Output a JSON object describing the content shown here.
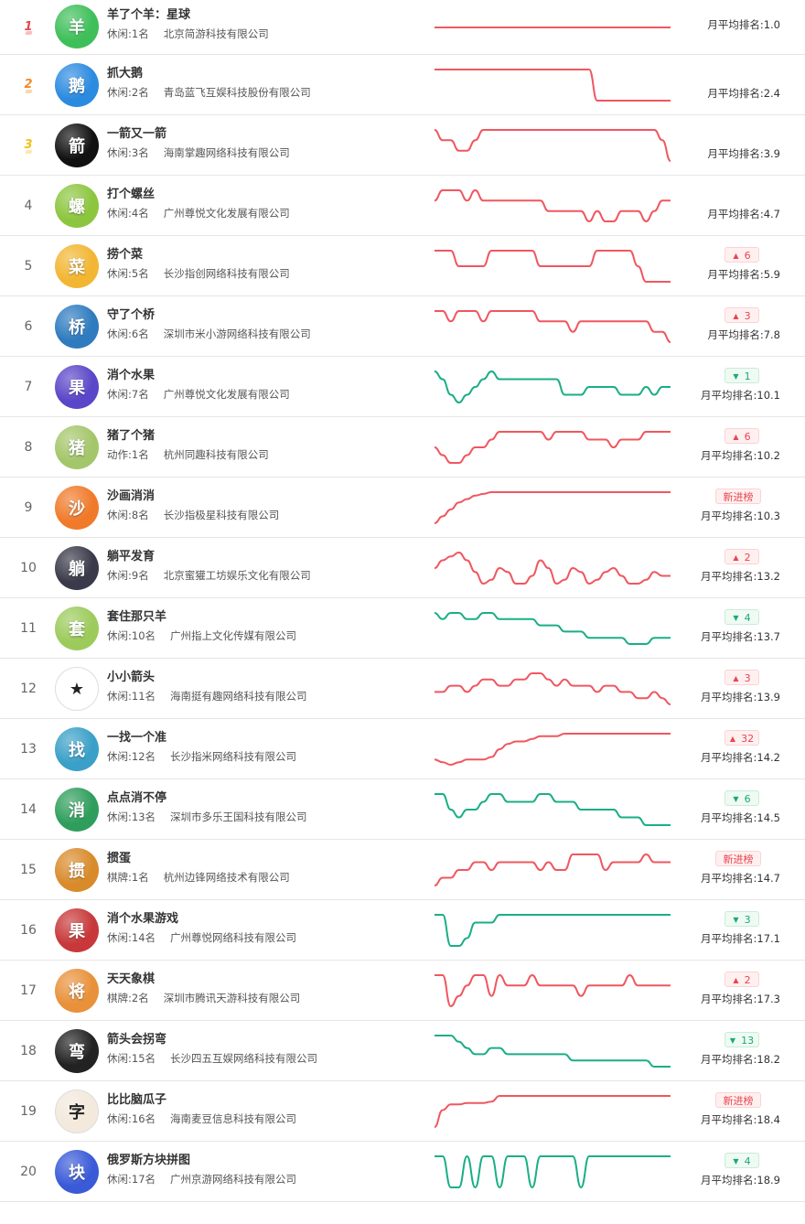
{
  "colors": {
    "up": "#e8464f",
    "down": "#18a979",
    "line_red": "#f0575f",
    "line_green": "#1aae86"
  },
  "rows": [
    {
      "rank": "1",
      "name": "羊了个羊：星球",
      "category": "休闲:1名",
      "company": "北京简游科技有限公司",
      "avg": "月平均排名:1.0",
      "badge": null,
      "badge_type": "none",
      "line_color": "red",
      "icon": "sheep-game-icon",
      "icon_text": "羊",
      "icon_bg": "#3fbf5a",
      "trend": [
        30,
        30,
        30,
        30,
        30,
        30,
        30,
        30,
        30,
        30,
        30,
        30,
        30,
        30,
        30,
        30,
        30,
        30,
        30,
        30,
        30,
        30,
        30,
        30,
        30,
        30,
        30,
        30,
        30,
        30
      ]
    },
    {
      "rank": "2",
      "name": "抓大鹅",
      "category": "休闲:2名",
      "company": "青岛蓝飞互娱科技股份有限公司",
      "avg": "月平均排名:2.4",
      "badge": null,
      "badge_type": "none",
      "line_color": "red",
      "icon": "goose-game-icon",
      "icon_text": "鹅",
      "icon_bg": "#2b8be0",
      "trend": [
        2,
        2,
        2,
        2,
        2,
        2,
        2,
        2,
        2,
        2,
        2,
        2,
        2,
        2,
        2,
        2,
        2,
        2,
        2,
        2,
        3,
        3,
        3,
        3,
        3,
        3,
        3,
        3,
        3,
        3
      ]
    },
    {
      "rank": "3",
      "name": "一箭又一箭",
      "category": "休闲:3名",
      "company": "海南掌趣网络科技有限公司",
      "avg": "月平均排名:3.9",
      "badge": null,
      "badge_type": "none",
      "line_color": "red",
      "icon": "arrow-game-icon",
      "icon_text": "箭",
      "icon_bg": "#111111",
      "trend": [
        3,
        4,
        4,
        5,
        5,
        4,
        3,
        3,
        3,
        3,
        3,
        3,
        3,
        3,
        3,
        3,
        3,
        3,
        3,
        3,
        3,
        3,
        3,
        3,
        3,
        3,
        3,
        3,
        4,
        6
      ]
    },
    {
      "rank": "4",
      "name": "打个螺丝",
      "category": "休闲:4名",
      "company": "广州尊悦文化发展有限公司",
      "avg": "月平均排名:4.7",
      "badge": null,
      "badge_type": "none",
      "line_color": "red",
      "icon": "screw-game-icon",
      "icon_text": "螺",
      "icon_bg": "#8cc63f",
      "trend": [
        3,
        2,
        2,
        2,
        3,
        2,
        3,
        3,
        3,
        3,
        3,
        3,
        3,
        3,
        4,
        4,
        4,
        4,
        4,
        5,
        4,
        5,
        5,
        4,
        4,
        4,
        5,
        4,
        3,
        3
      ]
    },
    {
      "rank": "5",
      "name": "捞个菜",
      "category": "休闲:5名",
      "company": "长沙指创网络科技有限公司",
      "avg": "月平均排名:5.9",
      "badge": "6",
      "badge_type": "up",
      "line_color": "red",
      "icon": "dish-game-icon",
      "icon_text": "菜",
      "icon_bg": "#f2b632",
      "trend": [
        5,
        5,
        5,
        6,
        6,
        6,
        6,
        5,
        5,
        5,
        5,
        5,
        5,
        6,
        6,
        6,
        6,
        6,
        6,
        6,
        5,
        5,
        5,
        5,
        5,
        6,
        7,
        7,
        7,
        7
      ]
    },
    {
      "rank": "6",
      "name": "守了个桥",
      "category": "休闲:6名",
      "company": "深圳市米小游网络科技有限公司",
      "avg": "月平均排名:7.8",
      "badge": "3",
      "badge_type": "up",
      "line_color": "red",
      "icon": "bridge-game-icon",
      "icon_text": "桥",
      "icon_bg": "#2e7bbf",
      "trend": [
        6,
        6,
        7,
        6,
        6,
        6,
        7,
        6,
        6,
        6,
        6,
        6,
        6,
        7,
        7,
        7,
        7,
        8,
        7,
        7,
        7,
        7,
        7,
        7,
        7,
        7,
        7,
        8,
        8,
        9
      ]
    },
    {
      "rank": "7",
      "name": "消个水果",
      "category": "休闲:7名",
      "company": "广州尊悦文化发展有限公司",
      "avg": "月平均排名:10.1",
      "badge": "1",
      "badge_type": "down",
      "line_color": "green",
      "icon": "fruit-game-icon",
      "icon_text": "果",
      "icon_bg": "#5a46c8",
      "trend": [
        8,
        9,
        11,
        12,
        11,
        10,
        9,
        8,
        9,
        9,
        9,
        9,
        9,
        9,
        9,
        9,
        11,
        11,
        11,
        10,
        10,
        10,
        10,
        11,
        11,
        11,
        10,
        11,
        10,
        10
      ]
    },
    {
      "rank": "8",
      "name": "猪了个猪",
      "category": "动作:1名",
      "company": "杭州同趣科技有限公司",
      "avg": "月平均排名:10.2",
      "badge": "6",
      "badge_type": "up",
      "line_color": "red",
      "icon": "pig-game-icon",
      "icon_text": "猪",
      "icon_bg": "#a4c66b",
      "trend": [
        12,
        13,
        14,
        14,
        13,
        12,
        12,
        11,
        10,
        10,
        10,
        10,
        10,
        10,
        11,
        10,
        10,
        10,
        10,
        11,
        11,
        11,
        12,
        11,
        11,
        11,
        10,
        10,
        10,
        10
      ]
    },
    {
      "rank": "9",
      "name": "沙画消消",
      "category": "休闲:8名",
      "company": "长沙指极星科技有限公司",
      "avg": "月平均排名:10.3",
      "badge": "新进榜",
      "badge_type": "new",
      "line_color": "red",
      "icon": "sand-game-icon",
      "icon_text": "沙",
      "icon_bg": "#f07a2a",
      "trend": [
        20,
        18,
        16,
        14,
        13,
        12,
        11.5,
        11,
        11,
        11,
        11,
        11,
        11,
        11,
        11,
        11,
        11,
        11,
        11,
        11,
        11,
        11,
        11,
        11,
        11,
        11,
        11,
        11,
        11,
        11
      ]
    },
    {
      "rank": "10",
      "name": "躺平发育",
      "category": "休闲:9名",
      "company": "北京蜜獾工坊娱乐文化有限公司",
      "avg": "月平均排名:13.2",
      "badge": "2",
      "badge_type": "up",
      "line_color": "red",
      "icon": "lying-game-icon",
      "icon_text": "躺",
      "icon_bg": "#3a3a4a",
      "trend": [
        13,
        11,
        10,
        9,
        11,
        14,
        17,
        16,
        13,
        14,
        17,
        17,
        15,
        11,
        13,
        17,
        16,
        13,
        14,
        17,
        16,
        14,
        13,
        15,
        17,
        17,
        16,
        14,
        15,
        15
      ]
    },
    {
      "rank": "11",
      "name": "套住那只羊",
      "category": "休闲:10名",
      "company": "广州指上文化传媒有限公司",
      "avg": "月平均排名:13.7",
      "badge": "4",
      "badge_type": "down",
      "line_color": "green",
      "icon": "lasso-sheep-icon",
      "icon_text": "套",
      "icon_bg": "#9ccb5c",
      "trend": [
        12,
        13,
        12,
        12,
        13,
        13,
        12,
        12,
        13,
        13,
        13,
        13,
        13,
        14,
        14,
        14,
        15,
        15,
        15,
        16,
        16,
        16,
        16,
        16,
        17,
        17,
        17,
        16,
        16,
        16
      ]
    },
    {
      "rank": "12",
      "name": "小小箭头",
      "category": "休闲:11名",
      "company": "海南挺有趣网络科技有限公司",
      "avg": "月平均排名:13.9",
      "badge": "3",
      "badge_type": "up",
      "line_color": "red",
      "icon": "arrow-star-icon",
      "icon_text": "★",
      "icon_bg": "#ffffff",
      "trend": [
        14,
        14,
        13,
        13,
        14,
        13,
        12,
        12,
        13,
        13,
        12,
        12,
        11,
        11,
        12,
        13,
        12,
        13,
        13,
        13,
        14,
        13,
        13,
        14,
        14,
        15,
        15,
        14,
        15,
        16
      ]
    },
    {
      "rank": "13",
      "name": "一找一个准",
      "category": "休闲:12名",
      "company": "长沙指米网络科技有限公司",
      "avg": "月平均排名:14.2",
      "badge": "32",
      "badge_type": "up",
      "line_color": "red",
      "icon": "find-game-icon",
      "icon_text": "找",
      "icon_bg": "#3aa0c8",
      "trend": [
        24,
        25,
        26,
        25,
        24,
        24,
        24,
        23,
        20,
        18,
        17,
        17,
        16,
        15,
        15,
        15,
        14,
        14,
        14,
        14,
        14,
        14,
        14,
        14,
        14,
        14,
        14,
        14,
        14,
        14
      ]
    },
    {
      "rank": "14",
      "name": "点点消不停",
      "category": "休闲:13名",
      "company": "深圳市多乐王国科技有限公司",
      "avg": "月平均排名:14.5",
      "badge": "6",
      "badge_type": "down",
      "line_color": "green",
      "icon": "tile-game-icon",
      "icon_text": "消",
      "icon_bg": "#2f9e5c",
      "trend": [
        13,
        13,
        15,
        16,
        15,
        15,
        14,
        13,
        13,
        14,
        14,
        14,
        14,
        13,
        13,
        14,
        14,
        14,
        15,
        15,
        15,
        15,
        15,
        16,
        16,
        16,
        17,
        17,
        17,
        17
      ]
    },
    {
      "rank": "15",
      "name": "掼蛋",
      "category": "棋牌:1名",
      "company": "杭州边锋网络技术有限公司",
      "avg": "月平均排名:14.7",
      "badge": "新进榜",
      "badge_type": "new",
      "line_color": "red",
      "icon": "guandan-game-icon",
      "icon_text": "掼",
      "icon_bg": "#d98b2b",
      "trend": [
        17,
        16,
        16,
        15,
        15,
        14,
        14,
        15,
        14,
        14,
        14,
        14,
        14,
        15,
        14,
        15,
        15,
        13,
        13,
        13,
        13,
        15,
        14,
        14,
        14,
        14,
        13,
        14,
        14,
        14
      ]
    },
    {
      "rank": "16",
      "name": "消个水果游戏",
      "category": "休闲:14名",
      "company": "广州尊悦网络科技有限公司",
      "avg": "月平均排名:17.1",
      "badge": "3",
      "badge_type": "down",
      "line_color": "green",
      "icon": "fruit-puzzle-icon",
      "icon_text": "果",
      "icon_bg": "#c8383a",
      "trend": [
        16,
        16,
        20,
        20,
        19,
        17,
        17,
        17,
        16,
        16,
        16,
        16,
        16,
        16,
        16,
        16,
        16,
        16,
        16,
        16,
        16,
        16,
        16,
        16,
        16,
        16,
        16,
        16,
        16,
        16
      ]
    },
    {
      "rank": "17",
      "name": "天天象棋",
      "category": "棋牌:2名",
      "company": "深圳市腾讯天游科技有限公司",
      "avg": "月平均排名:17.3",
      "badge": "2",
      "badge_type": "up",
      "line_color": "red",
      "icon": "chess-game-icon",
      "icon_text": "将",
      "icon_bg": "#e8913a",
      "trend": [
        16,
        16,
        19,
        18,
        17,
        16,
        16,
        18,
        16,
        17,
        17,
        17,
        16,
        17,
        17,
        17,
        17,
        17,
        18,
        17,
        17,
        17,
        17,
        17,
        16,
        17,
        17,
        17,
        17,
        17
      ]
    },
    {
      "rank": "18",
      "name": "箭头会拐弯",
      "category": "休闲:15名",
      "company": "长沙四五互娱网络科技有限公司",
      "avg": "月平均排名:18.2",
      "badge": "13",
      "badge_type": "down",
      "line_color": "green",
      "icon": "maze-arrow-icon",
      "icon_text": "弯",
      "icon_bg": "#222222",
      "trend": [
        15,
        15,
        15,
        16,
        17,
        18,
        18,
        17,
        17,
        18,
        18,
        18,
        18,
        18,
        18,
        18,
        18,
        19,
        19,
        19,
        19,
        19,
        19,
        19,
        19,
        19,
        19,
        20,
        20,
        20
      ]
    },
    {
      "rank": "19",
      "name": "比比脑瓜子",
      "category": "休闲:16名",
      "company": "海南麦豆信息科技有限公司",
      "avg": "月平均排名:18.4",
      "badge": "新进榜",
      "badge_type": "new",
      "line_color": "red",
      "icon": "brain-game-icon",
      "icon_text": "字",
      "icon_bg": "#f3e9dc",
      "trend": [
        30,
        24,
        22,
        22,
        21.5,
        21.5,
        21.5,
        21,
        19,
        19,
        19,
        19,
        19,
        19,
        19,
        19,
        19,
        19,
        19,
        19,
        19,
        19,
        19,
        19,
        19,
        19,
        19,
        19,
        19,
        19
      ]
    },
    {
      "rank": "20",
      "name": "俄罗斯方块拼图",
      "category": "休闲:17名",
      "company": "广州京游网络科技有限公司",
      "avg": "月平均排名:18.9",
      "badge": "4",
      "badge_type": "down",
      "line_color": "green",
      "icon": "tetris-game-icon",
      "icon_text": "块",
      "icon_bg": "#3a5ad8",
      "trend": [
        18,
        18,
        19,
        19,
        18,
        19,
        18,
        18,
        19,
        18,
        18,
        18,
        19,
        18,
        18,
        18,
        18,
        18,
        19,
        18,
        18,
        18,
        18,
        18,
        18,
        18,
        18,
        18,
        18,
        18
      ]
    }
  ]
}
